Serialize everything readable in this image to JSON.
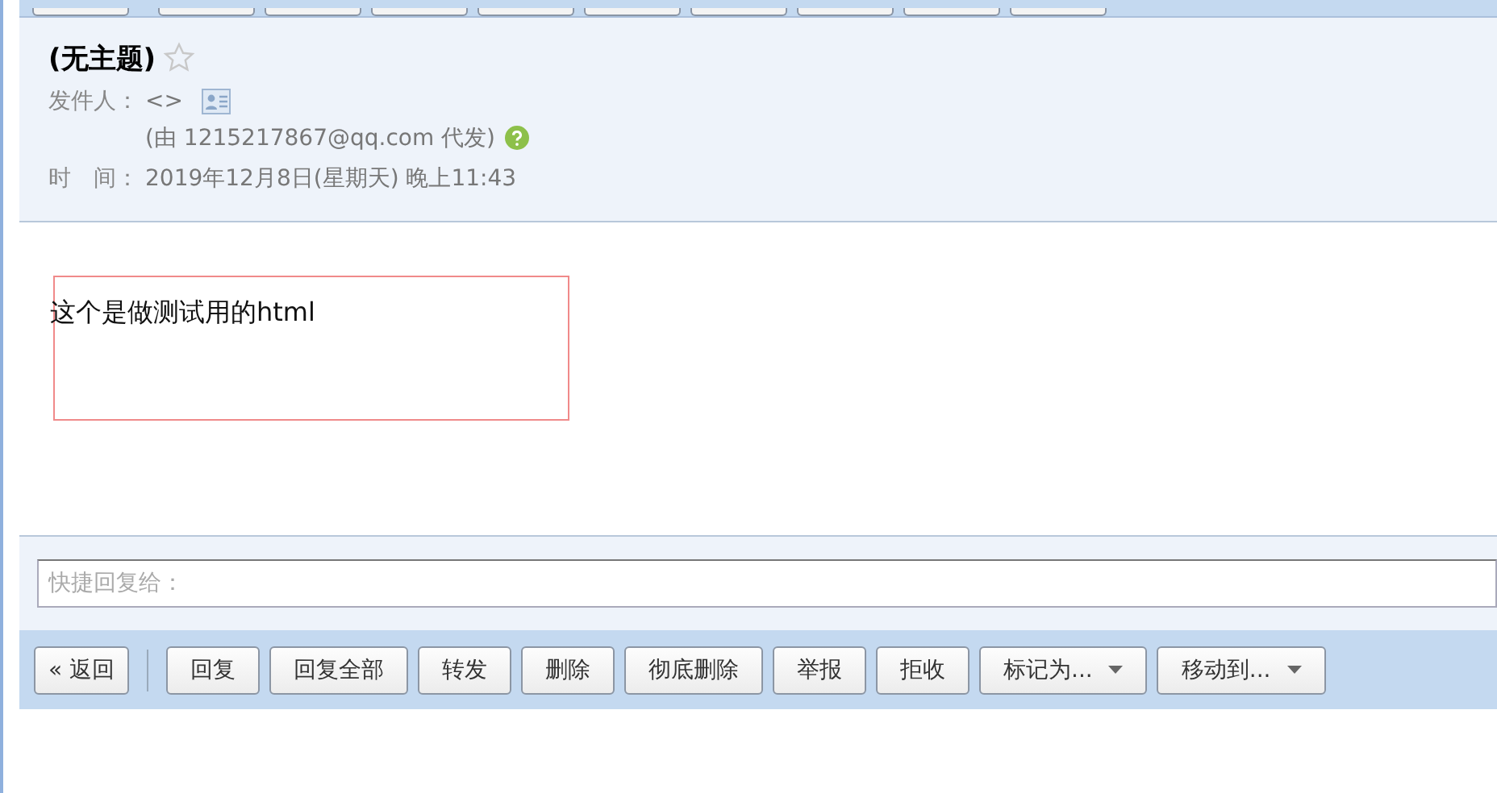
{
  "subject": "(无主题)",
  "starred": false,
  "sender_label": "发件人：",
  "sender": "<>",
  "proxy_note": "(由 1215217867@qq.com 代发)",
  "time_label": "时　间：",
  "time": "2019年12月8日(星期天) 晚上11:43",
  "body_text": "这个是做测试用的html",
  "quick_reply": {
    "placeholder": "快捷回复给："
  },
  "toolbar": [
    {
      "label": "« 返回",
      "kind": "back"
    },
    {
      "label": "回复",
      "kind": "plain"
    },
    {
      "label": "回复全部",
      "kind": "plain"
    },
    {
      "label": "转发",
      "kind": "plain"
    },
    {
      "label": "删除",
      "kind": "plain"
    },
    {
      "label": "彻底删除",
      "kind": "plain"
    },
    {
      "label": "举报",
      "kind": "plain"
    },
    {
      "label": "拒收",
      "kind": "plain"
    },
    {
      "label": "标记为...",
      "kind": "dropdown"
    },
    {
      "label": "移动到...",
      "kind": "dropdown"
    }
  ]
}
